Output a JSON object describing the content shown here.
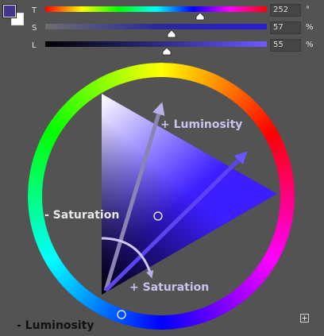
{
  "colors": {
    "foreground": "#42358c",
    "background": "#ffffff",
    "target_color": "#3c1eff"
  },
  "sliders": [
    {
      "letter": "T",
      "value": "252",
      "unit": "°",
      "level": 0.7
    },
    {
      "letter": "S",
      "value": "57",
      "unit": "%",
      "level": 0.57
    },
    {
      "letter": "L",
      "value": "55",
      "unit": "%",
      "level": 0.55
    }
  ],
  "annotations": {
    "plus_luminosity": "+ Luminosity",
    "minus_saturation": "- Saturation",
    "plus_saturation": "+ Saturation",
    "minus_luminosity": "- Luminosity"
  },
  "icons": {
    "add": "plus-box-icon"
  }
}
